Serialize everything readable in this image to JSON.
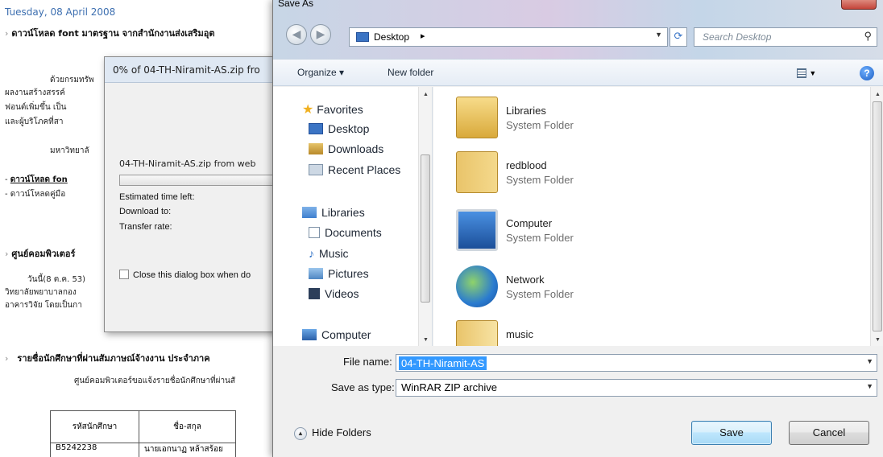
{
  "webpage": {
    "date": "Tuesday, 08 April 2008",
    "heading1": "ดาวน์โหลด font มาตรฐาน จากสำนักงานส่งเสริมอุต",
    "para_lines": [
      "ด้วยกรมทรัพ",
      "ผลงานสร้างสรรค์",
      "ฟอนต์เพิ่มขึ้น เป็น",
      "และผู้บริโภคที่สา",
      "มหาวิทยาลั"
    ],
    "link1": "ดาวน์โหลด fon",
    "link2": "ดาวน์โหลดคู่มือ",
    "heading2": "ศูนย์คอมพิวเตอร์",
    "para2_lines": [
      "วันนี้(8 ต.ค. 53)",
      "วิทยาลัยพยาบาลกอง",
      "อาคารวิจัย โดยเป็นกา"
    ],
    "heading3": "รายชื่อนักศึกษาที่ผ่านสัมภาษณ์จ้างงาน ประจำภาค",
    "para3": "ศูนย์คอมพิวเตอร์ขอแจ้งรายชื่อนักศึกษาที่ผ่านสั",
    "table": {
      "headers": [
        "รหัสนักศึกษา",
        "ชื่อ-สกุล"
      ],
      "rows": [
        [
          "B5242238",
          "นายเอกนาฏ หล้าสร้อย"
        ]
      ]
    }
  },
  "download_dialog": {
    "title": "0% of 04-TH-Niramit-AS.zip fro",
    "file_line": "04-TH-Niramit-AS.zip from web",
    "progress_percent": 0,
    "estimated_label": "Estimated time left:",
    "download_to_label": "Download to:",
    "transfer_rate_label": "Transfer rate:",
    "close_checkbox_label": "Close this dialog box when do"
  },
  "save_as": {
    "title": "Save As",
    "address": {
      "location": "Desktop",
      "arrow": "▸"
    },
    "search_placeholder": "Search Desktop",
    "toolbar": {
      "organize": "Organize ▾",
      "new_folder": "New folder"
    },
    "nav": {
      "favorites": "Favorites",
      "favorites_items": [
        "Desktop",
        "Downloads",
        "Recent Places"
      ],
      "libraries": "Libraries",
      "libraries_items": [
        "Documents",
        "Music",
        "Pictures",
        "Videos"
      ],
      "computer": "Computer"
    },
    "files": [
      {
        "name": "Libraries",
        "type": "System Folder"
      },
      {
        "name": "redblood",
        "type": "System Folder"
      },
      {
        "name": "Computer",
        "type": "System Folder"
      },
      {
        "name": "Network",
        "type": "System Folder"
      },
      {
        "name": "music",
        "type": ""
      }
    ],
    "file_name_label": "File name:",
    "file_name_value": "04-TH-Niramit-AS",
    "save_type_label": "Save as type:",
    "save_type_value": "WinRAR ZIP archive",
    "hide_folders": "Hide Folders",
    "save_button": "Save",
    "cancel_button": "Cancel"
  }
}
